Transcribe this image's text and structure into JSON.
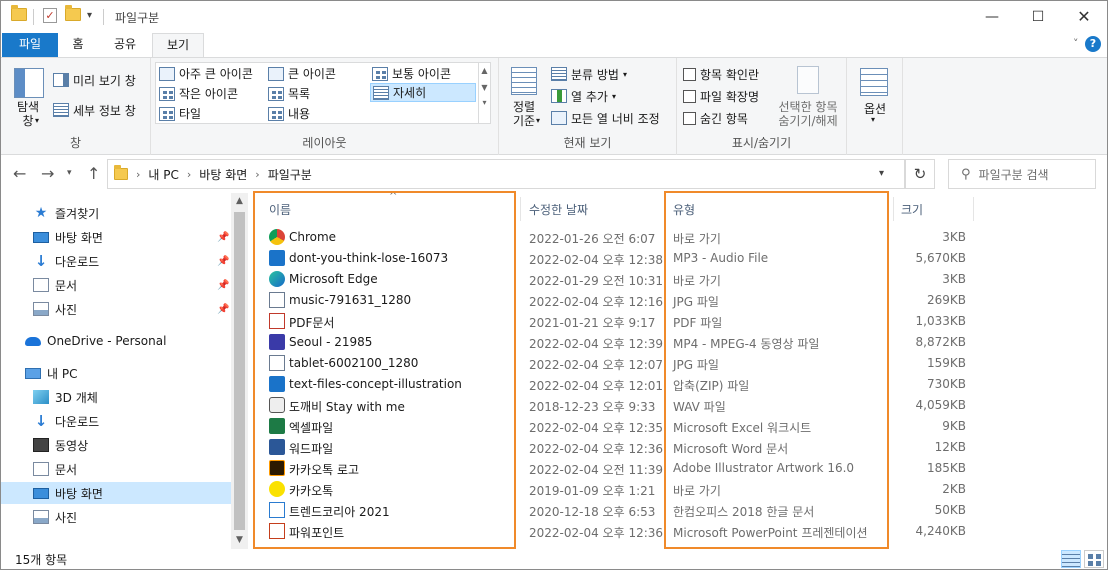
{
  "window": {
    "title": "파일구분"
  },
  "ribbon_tabs": [
    {
      "label": "파일"
    },
    {
      "label": "홈"
    },
    {
      "label": "공유"
    },
    {
      "label": "보기"
    }
  ],
  "ribbon": {
    "pane": {
      "nav_pane": "탐색\n창",
      "preview": "미리 보기 창",
      "details_pane": "세부 정보 창",
      "group": "창"
    },
    "layout": {
      "items": [
        "아주 큰 아이콘",
        "큰 아이콘",
        "보통 아이콘",
        "작은 아이콘",
        "목록",
        "자세히",
        "타일",
        "내용"
      ],
      "selected": "자세히",
      "group": "레이아웃"
    },
    "current_view": {
      "sort": "정렬\n기준",
      "group_by": "분류 방법",
      "add_columns": "열 추가",
      "fit_columns": "모든 열 너비 조정",
      "group": "현재 보기"
    },
    "show_hide": {
      "item_checkboxes": "항목 확인란",
      "extensions": "파일 확장명",
      "hidden_items": "숨긴 항목",
      "hide_selected": "선택한 항목\n숨기기/해제",
      "group": "표시/숨기기"
    },
    "options": "옵션"
  },
  "address": {
    "crumbs": [
      "내 PC",
      "바탕 화면",
      "파일구분"
    ],
    "search_placeholder": "파일구분 검색"
  },
  "nav": [
    {
      "label": "즐겨찾기",
      "icon": "star-icon"
    },
    {
      "label": "바탕 화면",
      "icon": "desktop-icon",
      "pinned": true
    },
    {
      "label": "다운로드",
      "icon": "download-icon",
      "pinned": true
    },
    {
      "label": "문서",
      "icon": "document-icon",
      "pinned": true
    },
    {
      "label": "사진",
      "icon": "picture-icon",
      "pinned": true
    },
    {
      "label": "OneDrive - Personal",
      "icon": "cloud-icon"
    },
    {
      "label": "내 PC",
      "icon": "pc-icon"
    },
    {
      "label": "3D 개체",
      "icon": "cube-icon"
    },
    {
      "label": "다운로드",
      "icon": "download-icon"
    },
    {
      "label": "동영상",
      "icon": "video-icon"
    },
    {
      "label": "문서",
      "icon": "document-icon"
    },
    {
      "label": "바탕 화면",
      "icon": "desktop-icon",
      "selected": true
    },
    {
      "label": "사진",
      "icon": "picture-icon"
    }
  ],
  "columns": {
    "name": "이름",
    "date": "수정한 날짜",
    "type": "유형",
    "size": "크기"
  },
  "files": [
    {
      "name": "Chrome",
      "date": "2022-01-26 오전 6:07",
      "type": "바로 가기",
      "size": "3KB",
      "icon": "chrome-icon"
    },
    {
      "name": "dont-you-think-lose-16073",
      "date": "2022-02-04 오후 12:38",
      "type": "MP3 - Audio File",
      "size": "5,670KB",
      "icon": "mp3-icon"
    },
    {
      "name": "Microsoft Edge",
      "date": "2022-01-29 오전 10:31",
      "type": "바로 가기",
      "size": "3KB",
      "icon": "edge-icon"
    },
    {
      "name": "music-791631_1280",
      "date": "2022-02-04 오후 12:16",
      "type": "JPG 파일",
      "size": "269KB",
      "icon": "jpg-icon"
    },
    {
      "name": "PDF문서",
      "date": "2021-01-21 오후 9:17",
      "type": "PDF 파일",
      "size": "1,033KB",
      "icon": "pdf-icon"
    },
    {
      "name": "Seoul - 21985",
      "date": "2022-02-04 오후 12:39",
      "type": "MP4 - MPEG-4 동영상 파일",
      "size": "8,872KB",
      "icon": "mp4-icon"
    },
    {
      "name": "tablet-6002100_1280",
      "date": "2022-02-04 오후 12:07",
      "type": "JPG 파일",
      "size": "159KB",
      "icon": "jpg-icon"
    },
    {
      "name": "text-files-concept-illustration",
      "date": "2022-02-04 오후 12:01",
      "type": "압축(ZIP) 파일",
      "size": "730KB",
      "icon": "zip-icon"
    },
    {
      "name": "도깨비 Stay with me",
      "date": "2018-12-23 오후 9:33",
      "type": "WAV 파일",
      "size": "4,059KB",
      "icon": "wav-icon"
    },
    {
      "name": "엑셀파일",
      "date": "2022-02-04 오후 12:35",
      "type": "Microsoft Excel 워크시트",
      "size": "9KB",
      "icon": "excel-icon"
    },
    {
      "name": "워드파일",
      "date": "2022-02-04 오후 12:36",
      "type": "Microsoft Word 문서",
      "size": "12KB",
      "icon": "word-icon"
    },
    {
      "name": "카카오톡 로고",
      "date": "2022-02-04 오전 11:39",
      "type": "Adobe Illustrator Artwork 16.0",
      "size": "185KB",
      "icon": "illustrator-icon"
    },
    {
      "name": "카카오톡",
      "date": "2019-01-09 오후 1:21",
      "type": "바로 가기",
      "size": "2KB",
      "icon": "kakaotalk-icon"
    },
    {
      "name": "트렌드코리아 2021",
      "date": "2020-12-18 오후 6:53",
      "type": "한컴오피스 2018 한글 문서",
      "size": "50KB",
      "icon": "hwp-icon"
    },
    {
      "name": "파워포인트",
      "date": "2022-02-04 오후 12:36",
      "type": "Microsoft PowerPoint 프레젠테이션",
      "size": "4,240KB",
      "icon": "ppt-icon"
    }
  ],
  "status": {
    "count": "15개 항목"
  },
  "colors": {
    "accent": "#1979ca",
    "highlight": "#f08a2a",
    "selection": "#cce8ff"
  }
}
